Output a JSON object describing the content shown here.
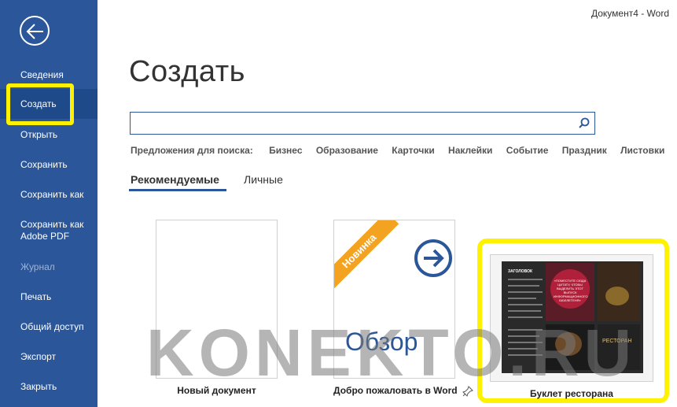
{
  "window": {
    "title": "Документ4  -  Word"
  },
  "sidebar": {
    "items": [
      {
        "label": "Сведения",
        "state": "normal"
      },
      {
        "label": "Создать",
        "state": "active"
      },
      {
        "label": "Открыть",
        "state": "normal"
      },
      {
        "label": "Сохранить",
        "state": "normal"
      },
      {
        "label": "Сохранить как",
        "state": "normal"
      },
      {
        "label": "Сохранить как\nAdobe PDF",
        "state": "normal"
      },
      {
        "label": "Журнал",
        "state": "disabled"
      },
      {
        "label": "Печать",
        "state": "normal"
      },
      {
        "label": "Общий доступ",
        "state": "normal"
      },
      {
        "label": "Экспорт",
        "state": "normal"
      },
      {
        "label": "Закрыть",
        "state": "normal"
      }
    ]
  },
  "main": {
    "title": "Создать",
    "search": {
      "value": "",
      "placeholder": ""
    },
    "suggestions": {
      "label": "Предложения для поиска:",
      "items": [
        "Бизнес",
        "Образование",
        "Карточки",
        "Наклейки",
        "Событие",
        "Праздник",
        "Листовки"
      ]
    },
    "tabs": [
      {
        "label": "Рекомендуемые",
        "active": true
      },
      {
        "label": "Личные",
        "active": false
      }
    ],
    "templates": [
      {
        "label": "Новый документ"
      },
      {
        "label": "Добро пожаловать в Word",
        "badge": "Новинка",
        "thumb_text": "Обзор"
      },
      {
        "label": "Буклет ресторана",
        "thumb": {
          "heading": "ЗАГОЛОВОК",
          "quote": "«ПОМЕСТИТЕ СЮДА ЦИТАТУ, ЧТОБЫ ВЫДЕЛИТЬ ЭТОТ ВЫПУСК ИНФОРМАЦИОННОГО БЮЛЛЕТЕНЯ»",
          "brand": "РЕСТОРАН"
        }
      }
    ]
  },
  "watermark": "KONEKTO.RU",
  "colors": {
    "sidebar": "#2b579a",
    "highlight": "#fff200",
    "ribbon": "#f4a320"
  }
}
